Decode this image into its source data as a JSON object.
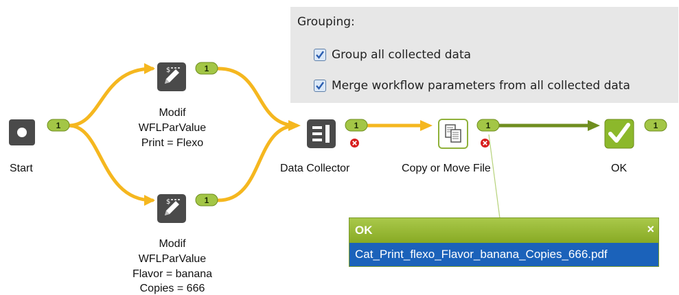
{
  "grouping": {
    "title": "Grouping:",
    "options": [
      {
        "label": "Group all collected data",
        "checked": true
      },
      {
        "label": "Merge workflow parameters from all collected data",
        "checked": true
      }
    ]
  },
  "nodes": {
    "start": {
      "label": "Start",
      "badge": "1"
    },
    "modif_top": {
      "lines": [
        "Modif",
        "WFLParValue",
        "Print = Flexo"
      ],
      "badge": "1"
    },
    "modif_bottom": {
      "lines": [
        "Modif",
        "WFLParValue",
        "Flavor = banana",
        "Copies = 666"
      ],
      "badge": "1"
    },
    "data_collector": {
      "label": "Data Collector",
      "badge": "1"
    },
    "copy_move": {
      "label": "Copy or Move File",
      "badge": "1"
    },
    "ok": {
      "label": "OK",
      "badge": "1"
    }
  },
  "ok_popup": {
    "title": "OK",
    "close_symbol": "×",
    "file": "Cat_Print_flexo_Flavor_banana_Copies_666.pdf"
  },
  "colors": {
    "flow_yellow": "#f5b71f",
    "flow_green": "#6f8e1f",
    "badge_green": "#a3c646",
    "icon_dark": "#4a4a4a",
    "ok_green": "#8cb82b",
    "selection_blue": "#1b62ba"
  }
}
